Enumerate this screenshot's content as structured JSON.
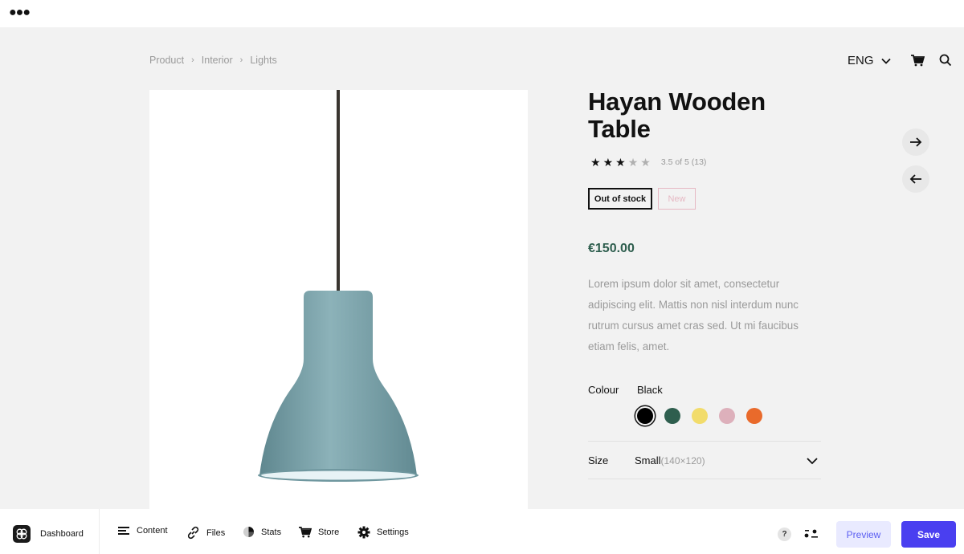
{
  "window": {
    "menu_icon": "more-horizontal-icon"
  },
  "breadcrumb": [
    "Product",
    "Interior",
    "Lights"
  ],
  "header": {
    "language": "ENG",
    "cart_icon": "cart-icon",
    "search_icon": "search-icon"
  },
  "product": {
    "title": "Hayan Wooden Table",
    "rating": {
      "value": 3,
      "max": 5,
      "text": "3.5 of 5 (13)"
    },
    "badges": {
      "stock": "Out of stock",
      "new": "New"
    },
    "price": "€150.00",
    "description": "Lorem ipsum dolor sit amet, consectetur adipiscing elit. Mattis non nisl interdum nunc rutrum cursus amet cras sed. Ut mi faucibus etiam felis, amet.",
    "colour": {
      "label": "Colour",
      "selected": "Black",
      "options": [
        {
          "name": "black",
          "color": "#000000"
        },
        {
          "name": "green",
          "color": "#2e5e4e"
        },
        {
          "name": "yellow",
          "color": "#f2dc6b"
        },
        {
          "name": "pink",
          "color": "#ddb0bb"
        },
        {
          "name": "orange",
          "color": "#e96a2b"
        }
      ]
    },
    "size": {
      "label": "Size",
      "value": "Small",
      "dimensions": "(140×120)"
    },
    "lamp_color": "#7ea5ad"
  },
  "toolbar": {
    "dashboard": "Dashboard",
    "content": "Content",
    "files": "Files",
    "stats": "Stats",
    "store": "Store",
    "settings": "Settings",
    "help": "?",
    "preview": "Preview",
    "save": "Save"
  },
  "colors": {
    "accent": "#4a3ff0",
    "price": "#2e5e4e",
    "canvas": "#f2f2f2"
  }
}
